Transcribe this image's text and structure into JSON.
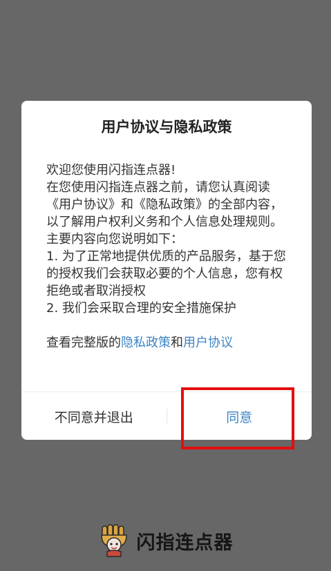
{
  "dialog": {
    "title": "用户协议与隐私政策",
    "body_lines": [
      "欢迎您使用闪指连点器!",
      "在您使用闪指连点器之前，请您认真阅读《用户协议》和《隐私政策》的全部内容，以了解用户权利义务和个人信息处理规则。主要内容向您说明如下：",
      "1. 为了正常地提供优质的产品服务，基于您的授权我们会获取必要的个人信息，您有权拒绝或者取消授权",
      "2. 我们会采取合理的安全措施保护"
    ],
    "view_full_prefix": "查看完整版的",
    "privacy_link": "隐私政策",
    "and_text": "和",
    "agreement_link": "用户协议"
  },
  "footer": {
    "disagree_label": "不同意并退出",
    "agree_label": "同意"
  },
  "brand": {
    "app_name": "闪指连点器",
    "logo_icon": "glove-mascot-icon"
  },
  "colors": {
    "overlay": "#676767",
    "link": "#3b84c4",
    "highlight": "#e30e0e"
  }
}
